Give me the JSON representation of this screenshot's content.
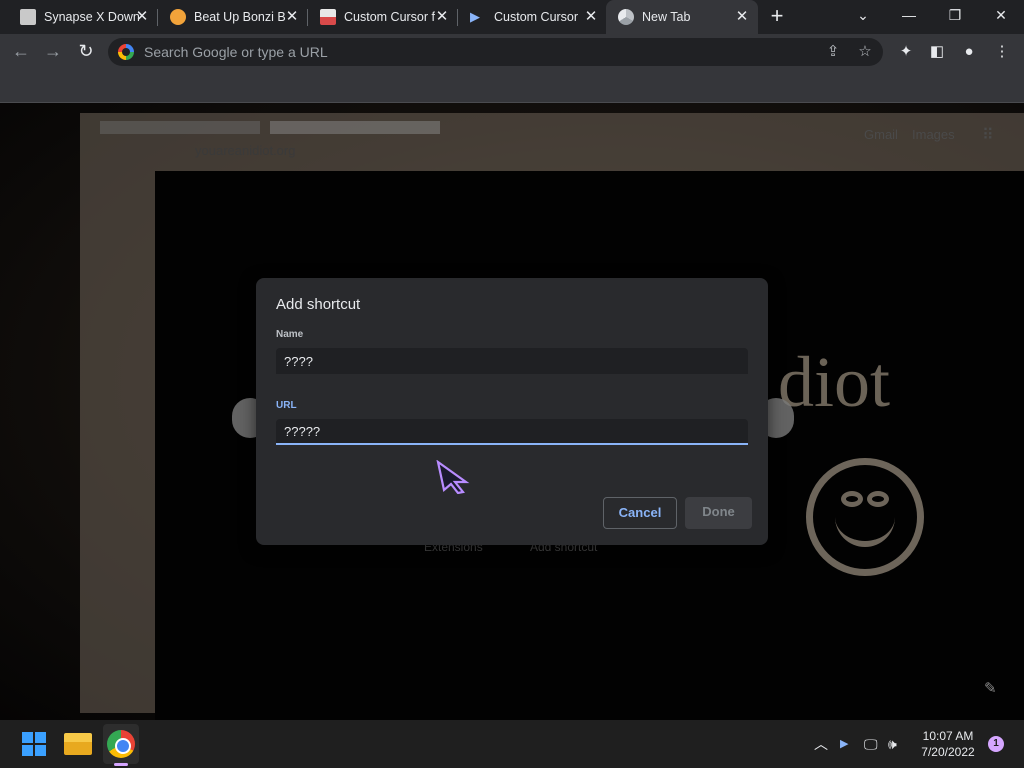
{
  "browser": {
    "tabs": [
      {
        "title": "Synapse X Down",
        "active": false
      },
      {
        "title": "Beat Up Bonzi B",
        "active": false
      },
      {
        "title": "Custom Cursor f",
        "active": false
      },
      {
        "title": "Custom Cursor",
        "active": false
      },
      {
        "title": "New Tab",
        "active": true
      }
    ],
    "new_tab_symbol": "+",
    "omnibox": {
      "placeholder": "Search Google or type a URL",
      "value": ""
    }
  },
  "page_background": {
    "photo_url_text": "youareanidiot.org",
    "gmail_link": "Gmail",
    "images_link": "Images",
    "partial_text": "diot",
    "extensions_label": "Extensions",
    "add_shortcut_label": "Add shortcut"
  },
  "dialog": {
    "title": "Add shortcut",
    "name_label": "Name",
    "name_value": "????",
    "url_label": "URL",
    "url_value": "?????",
    "cancel_label": "Cancel",
    "done_label": "Done",
    "colors": {
      "accent": "#8ab4f8",
      "background": "#292a2d"
    }
  },
  "taskbar": {
    "time": "10:07 AM",
    "date": "7/20/2022",
    "notification_count": "1",
    "pinned_apps": [
      "windows-start-icon",
      "file-explorer-icon",
      "chrome-icon"
    ]
  }
}
